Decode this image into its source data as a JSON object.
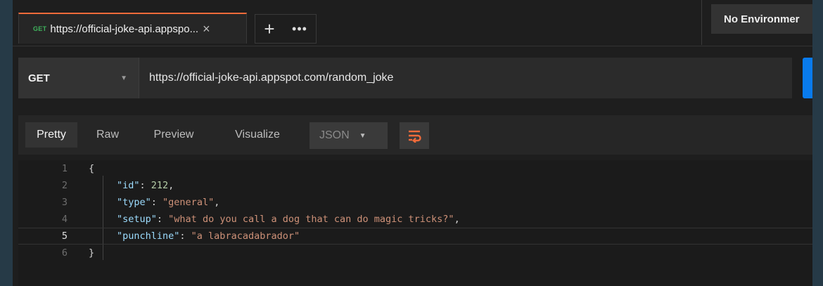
{
  "tab": {
    "method": "GET",
    "title": "https://official-joke-api.appspo...",
    "close": "×"
  },
  "tab_buttons": {
    "new_tab": "+",
    "more": "•••"
  },
  "environment": {
    "label": "No Environmer"
  },
  "request": {
    "method": "GET",
    "url": "https://official-joke-api.appspot.com/random_joke"
  },
  "response_tabs": [
    "Pretty",
    "Raw",
    "Preview",
    "Visualize"
  ],
  "active_response_tab": "Pretty",
  "format": {
    "selected": "JSON"
  },
  "code_lines": [
    {
      "num": "1",
      "text": "{"
    },
    {
      "num": "2",
      "key": "\"id\"",
      "value": "212",
      "value_type": "number",
      "suffix": ","
    },
    {
      "num": "3",
      "key": "\"type\"",
      "value": "\"general\"",
      "value_type": "string",
      "suffix": ","
    },
    {
      "num": "4",
      "key": "\"setup\"",
      "value": "\"what do you call a dog that can do magic tricks?\"",
      "value_type": "string",
      "suffix": ","
    },
    {
      "num": "5",
      "key": "\"punchline\"",
      "value": "\"a labracadabrador\"",
      "value_type": "string",
      "suffix": "",
      "current": true
    },
    {
      "num": "6",
      "text": "}"
    }
  ],
  "colors": {
    "accent": "#f26b3a",
    "method_get": "#3fb15c",
    "send_blue": "#097bed",
    "json_key": "#9cdcfe",
    "json_string": "#ce9178",
    "json_number": "#b5cea8"
  },
  "icons": {
    "wrap": "text-wrap-icon",
    "caret": "caret-down-icon"
  }
}
